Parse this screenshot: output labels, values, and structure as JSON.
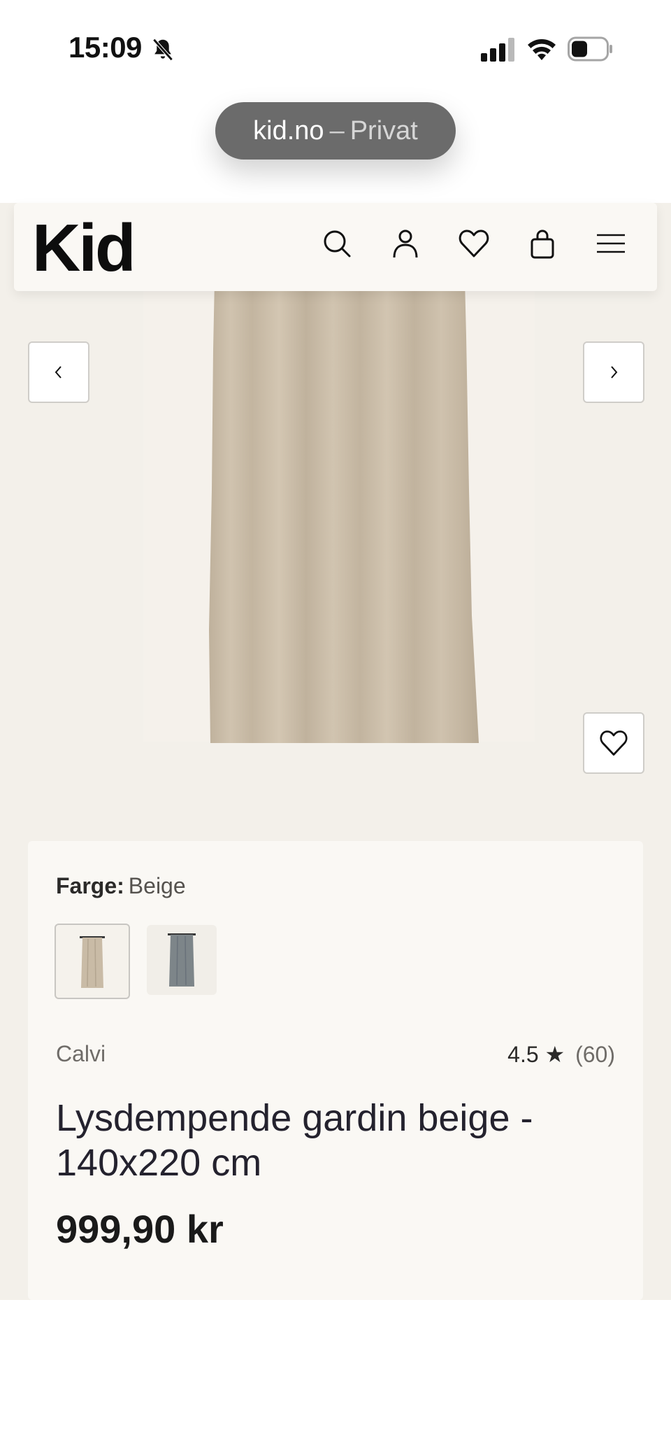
{
  "status_bar": {
    "time": "15:09",
    "icons": [
      "bell-slash-icon",
      "signal-icon",
      "wifi-icon",
      "battery-icon"
    ]
  },
  "browser": {
    "domain": "kid.no",
    "separator": "–",
    "mode": "Privat"
  },
  "header": {
    "logo": "Kid",
    "icons": [
      "search-icon",
      "user-icon",
      "heart-icon",
      "bag-icon",
      "menu-icon"
    ]
  },
  "gallery": {
    "prev_icon": "chevron-left-icon",
    "next_icon": "chevron-right-icon",
    "favorite_icon": "heart-icon"
  },
  "product": {
    "color_label": "Farge:",
    "color_value": "Beige",
    "swatches": [
      {
        "name": "Beige",
        "color": "#c9bba6",
        "selected": true
      },
      {
        "name": "Grå",
        "color": "#7d8589",
        "selected": false
      }
    ],
    "brand": "Calvi",
    "rating": "4.5",
    "rating_star": "★",
    "rating_count": "(60)",
    "title": "Lysdempende gardin beige - 140x220 cm",
    "price": "999,90 kr"
  },
  "colors": {
    "page_bg": "#f3f0ea",
    "card_bg": "#faf8f4",
    "curtain": "#c9bba6"
  }
}
